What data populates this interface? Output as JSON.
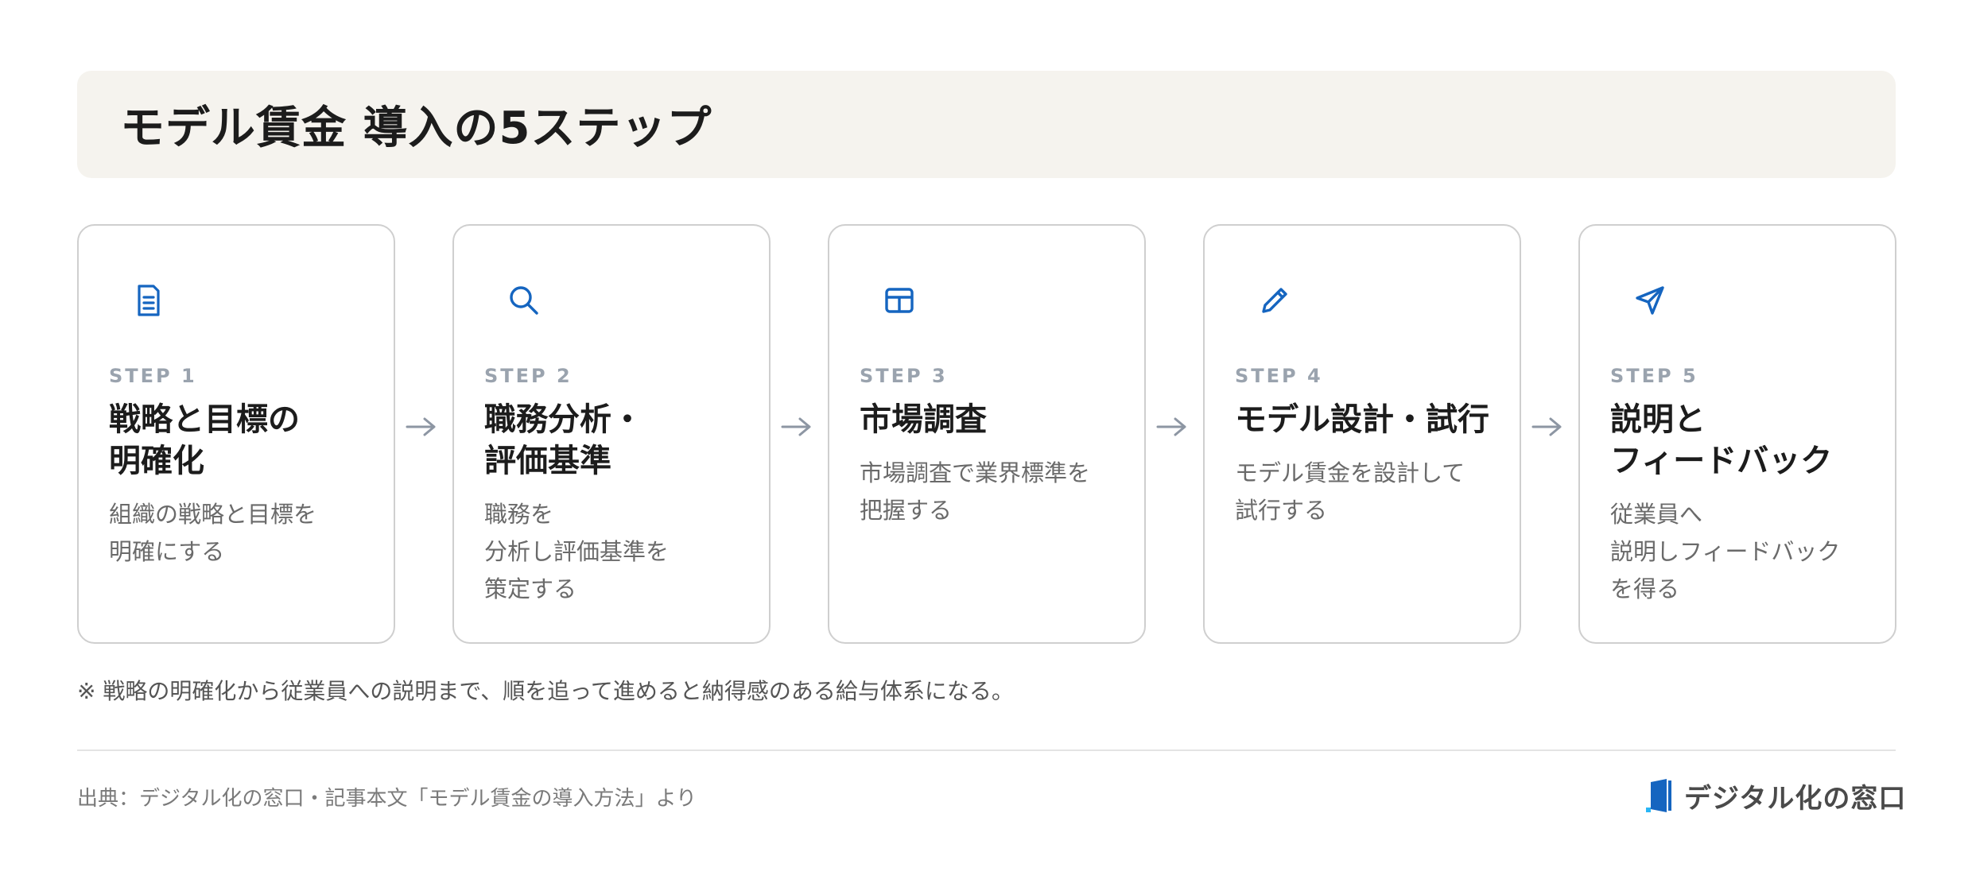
{
  "title": "モデル賃金 導入の5ステップ",
  "colors": {
    "accent": "#1565c0",
    "card_border": "#cfcfcf",
    "title_bg": "#f5f3ee",
    "step_label": "#9aa3ae"
  },
  "steps": [
    {
      "label": "STEP 1",
      "title": "戦略と目標の\n明確化",
      "desc": "組織の戦略と目標を\n明確にする",
      "icon": "document-icon"
    },
    {
      "label": "STEP 2",
      "title": "職務分析・\n評価基準",
      "desc": "職務を\n分析し評価基準を\n策定する",
      "icon": "search-icon"
    },
    {
      "label": "STEP 3",
      "title": "市場調査",
      "desc": "市場調査で業界標準を\n把握する",
      "icon": "table-icon"
    },
    {
      "label": "STEP 4",
      "title": "モデル設計・試行",
      "desc": "モデル賃金を設計して\n試行する",
      "icon": "pencil-icon"
    },
    {
      "label": "STEP 5",
      "title": "説明と\nフィードバック",
      "desc": "従業員へ\n説明しフィードバック\nを得る",
      "icon": "send-icon"
    }
  ],
  "note": "※ 戦略の明確化から従業員への説明まで、順を追って進めると納得感のある給与体系になる。",
  "source": "出典：デジタル化の窓口・記事本文「モデル賃金の導入方法」より",
  "logo_text": "デジタル化の窓口"
}
